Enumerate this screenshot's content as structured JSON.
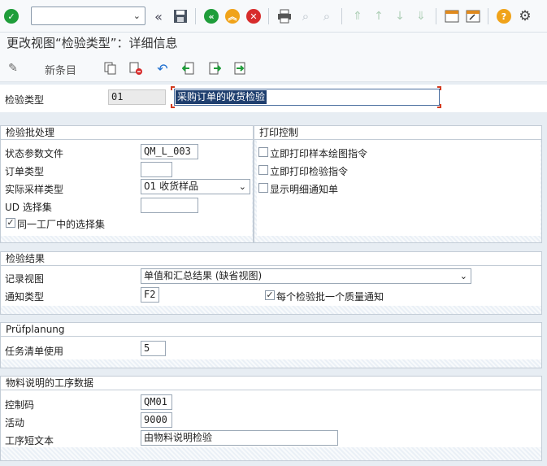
{
  "toolbar": {
    "command_field_value": "",
    "icons": [
      "enter-icon",
      "back-nav-icon",
      "save-icon",
      "back-icon",
      "exit-icon",
      "cancel-icon",
      "print-icon",
      "find-icon",
      "find-next-icon",
      "first-page-icon",
      "prev-page-icon",
      "next-page-icon",
      "last-page-icon",
      "new-session-icon",
      "shortcut-icon",
      "help-icon",
      "settings-icon"
    ]
  },
  "title": "更改视图“检验类型”：详细信息",
  "app_toolbar": {
    "new_entries_label": "新条目"
  },
  "header": {
    "inspection_type_label": "检验类型",
    "inspection_type_value": "01",
    "inspection_type_text": "采购订单的收货检验"
  },
  "lot_processing": {
    "title": "检验批处理",
    "status_profile_label": "状态参数文件",
    "status_profile_value": "QM_L_003",
    "order_type_label": "订单类型",
    "order_type_value": "",
    "sampling_type_label": "实际采样类型",
    "sampling_type_value": "01 收货样品",
    "ud_selected_set_label": "UD 选择集",
    "ud_selected_set_value": "",
    "same_plant_label": "同一工厂中的选择集",
    "same_plant_checked": true
  },
  "print_control": {
    "title": "打印控制",
    "print_sample_label": "立即打印样本绘图指令",
    "print_sample_checked": false,
    "print_inspection_label": "立即打印检验指令",
    "print_inspection_checked": false,
    "show_notification_label": "显示明细通知单",
    "show_notification_checked": false
  },
  "inspection_results": {
    "title": "检验结果",
    "record_view_label": "记录视图",
    "record_view_value": "单值和汇总结果 (缺省视图)",
    "notification_type_label": "通知类型",
    "notification_type_value": "F2",
    "one_notification_label": "每个检验批一个质量通知",
    "one_notification_checked": true
  },
  "pruefplanung": {
    "title": "Prüfplanung",
    "task_list_usage_label": "任务清单使用",
    "task_list_usage_value": "5"
  },
  "operation_data": {
    "title": "物料说明的工序数据",
    "control_key_label": "控制码",
    "control_key_value": "QM01",
    "activity_label": "活动",
    "activity_value": "9000",
    "operation_text_label": "工序短文本",
    "operation_text_value": "由物料说明检验"
  },
  "colors": {
    "enter_green": "#1f9d3a",
    "back_green": "#1f9d3a",
    "exit_orange": "#f0a31a",
    "cancel_red": "#d72c2c",
    "help_orange": "#f0a31a",
    "selection_blue": "#1f3f6f"
  }
}
